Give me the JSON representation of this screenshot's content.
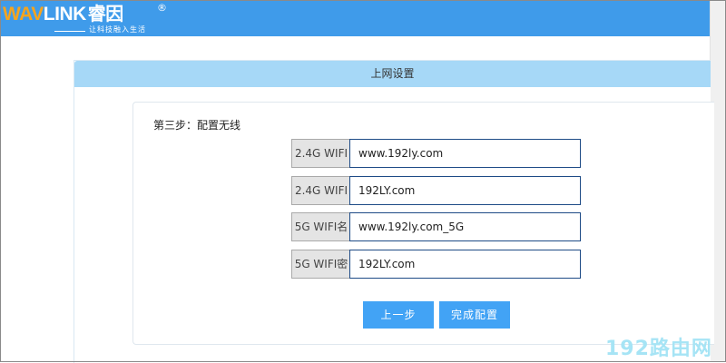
{
  "header": {
    "logo_wav": "WAV",
    "logo_link": "LINK",
    "logo_cn": "睿因",
    "logo_reg": "®",
    "slogan": "让科技融入生活"
  },
  "panel": {
    "title": "上网设置"
  },
  "step": {
    "title": "第三步：配置无线"
  },
  "fields": [
    {
      "label": "2.4G WIFI",
      "value": "www.192ly.com"
    },
    {
      "label": "2.4G WIFI",
      "value": "192LY.com"
    },
    {
      "label": "5G WIFI名",
      "value": "www.192ly.com_5G"
    },
    {
      "label": "5G WIFI密",
      "value": "192LY.com"
    }
  ],
  "buttons": {
    "prev": "上一步",
    "finish": "完成配置"
  },
  "watermark": "192路由网",
  "colors": {
    "header_bg": "#3f9bea",
    "panel_header_bg": "#a6d8f7",
    "button_bg": "#42a3f5",
    "logo_accent": "#f5a41e"
  }
}
